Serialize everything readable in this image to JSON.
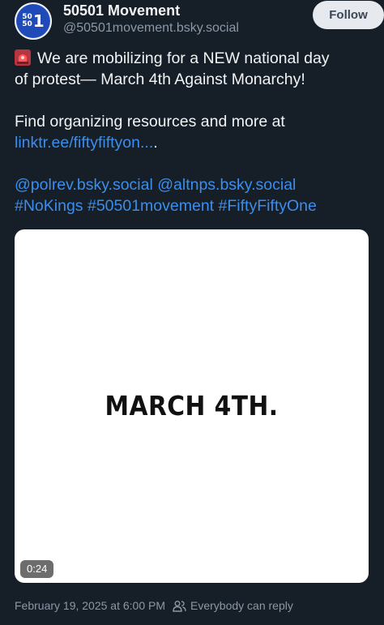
{
  "author": {
    "display_name": "50501 Movement",
    "handle": "@50501movement.bsky.social",
    "avatar": {
      "small_top": "50",
      "small_bottom": "50",
      "big": "1",
      "color": "#1f4ab8"
    }
  },
  "follow_label": "Follow",
  "post": {
    "line1": "We are mobilizing for a NEW national day",
    "line2": "of protest— March 4th Against Monarchy!",
    "line3": "Find organizing resources and more at",
    "link": "linktr.ee/fiftyfiftyon...",
    "link_suffix": ".",
    "mention1": "@polrev.bsky.social",
    "mention2": "@altnps.bsky.social",
    "tag1": "#NoKings",
    "tag2": "#50501movement",
    "tag3": "#FiftyFiftyOne",
    "emoji_icon": "police-light-icon"
  },
  "media": {
    "title": "MARCH 4TH.",
    "duration": "0:24"
  },
  "footer": {
    "timestamp": "February 19, 2025 at 6:00 PM",
    "reply_setting": "Everybody can reply"
  },
  "colors": {
    "background": "#161e27",
    "link": "#3b8eed",
    "muted": "#8b98a5",
    "follow_bg": "#e6eaee"
  }
}
